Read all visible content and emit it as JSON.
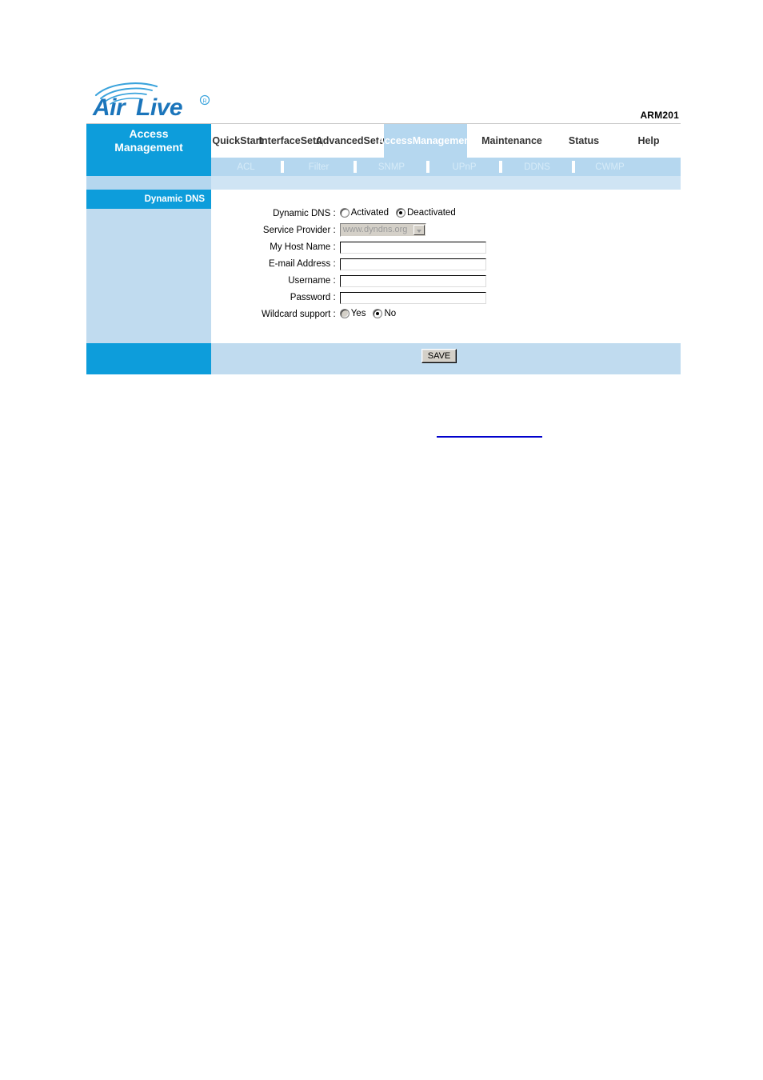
{
  "header": {
    "logo_alt": "AirLive",
    "logo_text_air": "Air",
    "logo_text_live": "Live",
    "logo_registered": "®",
    "model": "ARM201"
  },
  "nav": {
    "brand_line1": "Access",
    "brand_line2": "Management",
    "items": [
      {
        "line1": "Quick",
        "line2": "Start",
        "active": false
      },
      {
        "line1": "Interface",
        "line2": "Setup",
        "active": false
      },
      {
        "line1": "Advanced",
        "line2": "Setup",
        "active": false
      },
      {
        "line1": "Access",
        "line2": "Management",
        "active": true
      },
      {
        "line1": "Maintenance",
        "line2": "",
        "active": false
      },
      {
        "line1": "Status",
        "line2": "",
        "active": false
      },
      {
        "line1": "Help",
        "line2": "",
        "active": false
      }
    ]
  },
  "subtabs": [
    {
      "label": "ACL"
    },
    {
      "label": "Filter"
    },
    {
      "label": "SNMP"
    },
    {
      "label": "UPnP"
    },
    {
      "label": "DDNS"
    },
    {
      "label": "CWMP"
    }
  ],
  "panel": {
    "section_title": "Dynamic DNS"
  },
  "form": {
    "dynamic_dns": {
      "label": "Dynamic DNS :",
      "options": [
        {
          "label": "Activated",
          "checked": false,
          "disabled": false
        },
        {
          "label": "Deactivated",
          "checked": true,
          "disabled": false
        }
      ]
    },
    "service_provider": {
      "label": "Service Provider :",
      "value": "www.dyndns.org",
      "disabled": true
    },
    "my_host_name": {
      "label": "My Host Name :",
      "value": "",
      "placeholder": ""
    },
    "email_address": {
      "label": "E-mail Address :",
      "value": "",
      "placeholder": ""
    },
    "username": {
      "label": "Username :",
      "value": "",
      "placeholder": ""
    },
    "password": {
      "label": "Password :",
      "value": "",
      "placeholder": ""
    },
    "wildcard_support": {
      "label": "Wildcard support :",
      "options": [
        {
          "label": "Yes",
          "checked": false,
          "disabled": true
        },
        {
          "label": "No",
          "checked": true,
          "disabled": false
        }
      ]
    }
  },
  "footer": {
    "save_label": "SAVE"
  },
  "colors": {
    "brand_blue": "#0d9ddb",
    "tab_blue": "#b5d7ef",
    "panel_blue": "#c0dbef",
    "spacer_blue": "#cfe4f4",
    "link_blue": "#0000cc",
    "logo_blue": "#1b75bb"
  }
}
